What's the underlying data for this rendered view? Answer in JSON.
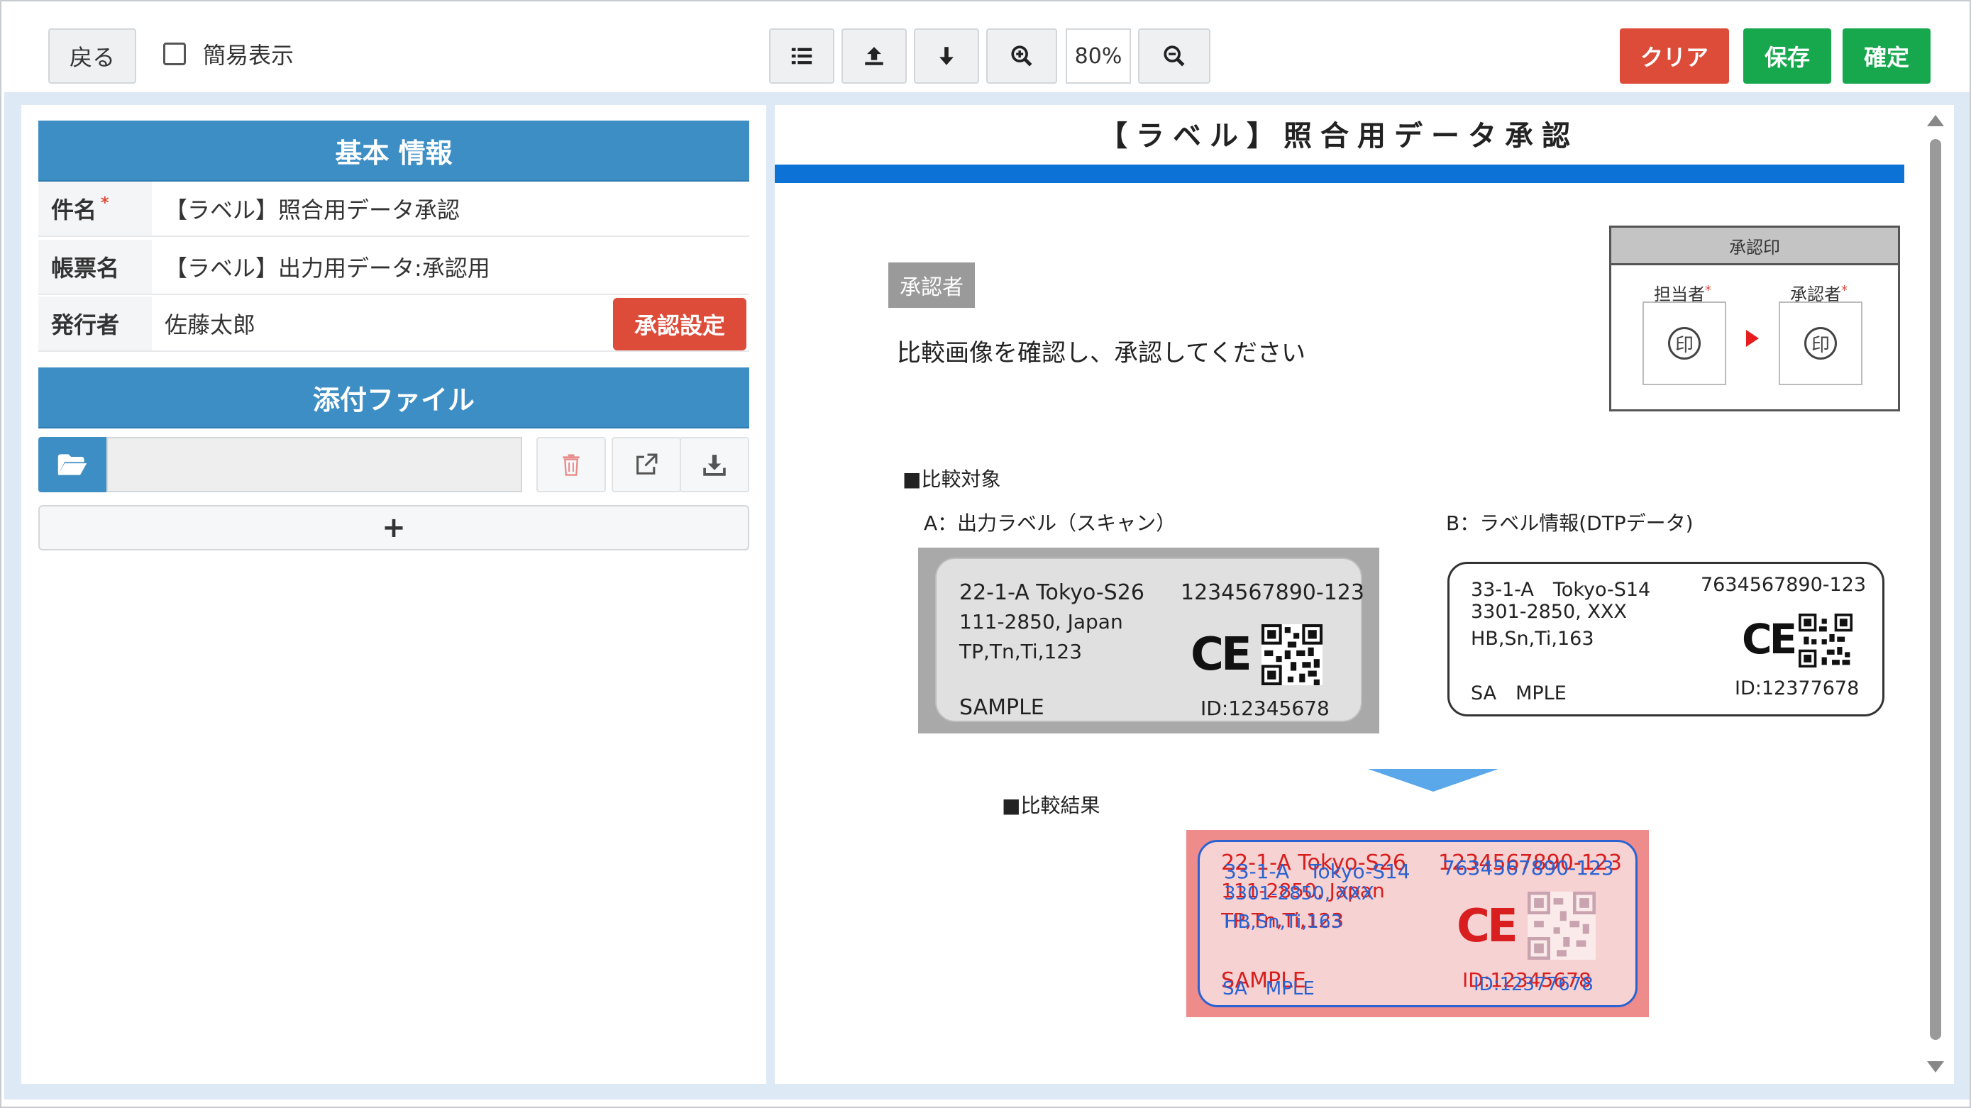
{
  "toolbar": {
    "back_label": "戻る",
    "simple_view_label": "簡易表示",
    "zoom_value": "80%",
    "clear_label": "クリア",
    "save_label": "保存",
    "confirm_label": "確定",
    "icons": [
      "list-icon",
      "upload-icon",
      "download-arrow-icon",
      "zoom-in-icon",
      "zoom-out-icon"
    ]
  },
  "basic_info": {
    "header": "基本 情報",
    "rows": [
      {
        "key": "件名",
        "required": "*",
        "value": "【ラベル】照合用データ承認"
      },
      {
        "key": "帳票名",
        "value": "【ラベル】出力用データ:承認用"
      },
      {
        "key": "発行者",
        "value": "佐藤太郎"
      }
    ],
    "approval_setting_label": "承認設定"
  },
  "attachments": {
    "header": "添付ファイル",
    "add_label": "+"
  },
  "document": {
    "title": "【ラベル】照合用データ承認",
    "approver_badge": "承認者",
    "instruction": "比較画像を確認し、承認してください",
    "stamp": {
      "title": "承認印",
      "person_label": "担当者",
      "approver_label": "承認者",
      "required_mark": "*",
      "seal_char": "印"
    },
    "compare_heading": "■比較対象",
    "a_heading": "A：出力ラベル（スキャン）",
    "b_heading": "B：ラベル情報(DTPデータ)",
    "result_heading": "■比較結果",
    "label_a": {
      "line1": "22-1-A Tokyo-S26",
      "number": "1234567890-123",
      "line2": "111-2850, Japan",
      "line3": "TP,Tn,Ti,123",
      "sample": "SAMPLE",
      "id": "ID:12345678",
      "mark": "CE"
    },
    "label_b": {
      "line1": "33-1-A　Tokyo-S14",
      "number": "7634567890-123",
      "line2": "3301-2850, XXX",
      "line3": "HB,Sn,Ti,163",
      "sample": "SA　MPLE",
      "id": "ID:12377678",
      "mark": "CE"
    },
    "overlay_colors": {
      "diff_a": "#d81e1e",
      "diff_b": "#2a62d2"
    }
  },
  "colors": {
    "header_blue": "#3d8ec4",
    "danger": "#dd4b39",
    "success": "#17a84e",
    "doc_bar": "#0c72d6"
  }
}
